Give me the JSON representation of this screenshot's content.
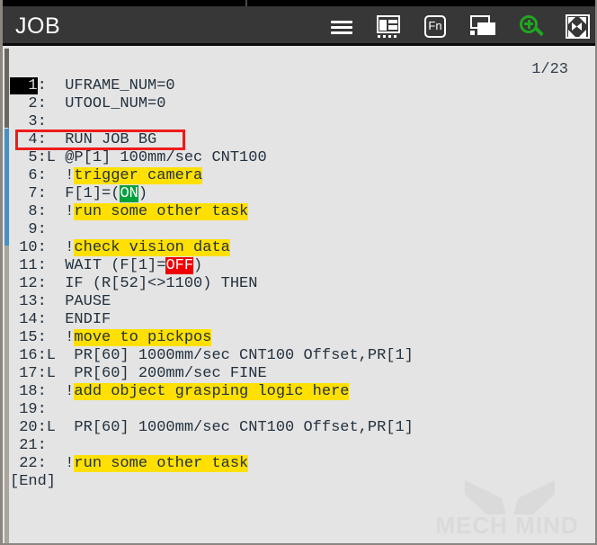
{
  "header": {
    "title": "JOB",
    "icons": [
      {
        "name": "hamburger-menu-icon",
        "label": "menu"
      },
      {
        "name": "layout-view-icon",
        "label": "layout"
      },
      {
        "name": "fn-key-icon",
        "label": "Fn"
      },
      {
        "name": "windows-switch-icon",
        "label": "windows"
      },
      {
        "name": "zoom-in-icon",
        "label": "zoom in"
      },
      {
        "name": "fullscreen-icon",
        "label": "fullscreen"
      }
    ],
    "fn_label": "Fn"
  },
  "body": {
    "page_indicator": "1/23",
    "end_marker": "[End]"
  },
  "colors": {
    "header_bg": "#373737",
    "body_bg": "#e4e4e4",
    "highlight_yellow": "#ffe000",
    "highlight_green": "#00a03c",
    "highlight_red": "#ee0000",
    "box_red": "#ee1b1b",
    "scroll_blue": "#4a8ec2",
    "zoom_green": "#22a522",
    "text": "#23313f"
  },
  "program": {
    "lines": [
      {
        "no": "  1",
        "sep": ":",
        "code": "  UFRAME_NUM=0",
        "cursor": true
      },
      {
        "no": "  2",
        "sep": ":",
        "code": "  UTOOL_NUM=0"
      },
      {
        "no": "  3",
        "sep": ":",
        "code": ""
      },
      {
        "no": "  4",
        "sep": ":",
        "code": "  RUN JOB BG",
        "boxed": true
      },
      {
        "no": "  5",
        "sep": ":L",
        "code": " @P[1] 100mm/sec CNT100"
      },
      {
        "no": "  6",
        "sep": ":",
        "code": "  !",
        "comment": "trigger camera"
      },
      {
        "no": "  7",
        "sep": ":",
        "code": "  F[1]=(",
        "green": "ON",
        "after": ")"
      },
      {
        "no": "  8",
        "sep": ":",
        "code": "  !",
        "comment": "run some other task"
      },
      {
        "no": "  9",
        "sep": ":",
        "code": ""
      },
      {
        "no": " 10",
        "sep": ":",
        "code": "  !",
        "comment": "check vision data"
      },
      {
        "no": " 11",
        "sep": ":",
        "code": "  WAIT (F[1]=",
        "red": "OFF",
        "after": ")"
      },
      {
        "no": " 12",
        "sep": ":",
        "code": "  IF (R[52]<>1100) THEN"
      },
      {
        "no": " 13",
        "sep": ":",
        "code": "  PAUSE"
      },
      {
        "no": " 14",
        "sep": ":",
        "code": "  ENDIF"
      },
      {
        "no": " 15",
        "sep": ":",
        "code": "  !",
        "comment": "move to pickpos"
      },
      {
        "no": " 16",
        "sep": ":L",
        "code": "  PR[60] 1000mm/sec CNT100 Offset,PR[1]"
      },
      {
        "no": " 17",
        "sep": ":L",
        "code": "  PR[60] 200mm/sec FINE"
      },
      {
        "no": " 18",
        "sep": ":",
        "code": "  !",
        "comment": "add object grasping logic here"
      },
      {
        "no": " 19",
        "sep": ":",
        "code": ""
      },
      {
        "no": " 20",
        "sep": ":L",
        "code": "  PR[60] 1000mm/sec CNT100 Offset,PR[1]"
      },
      {
        "no": " 21",
        "sep": ":",
        "code": ""
      },
      {
        "no": " 22",
        "sep": ":",
        "code": "  !",
        "comment": "run some other task"
      }
    ]
  },
  "watermark": {
    "text": "MECH MIND"
  }
}
